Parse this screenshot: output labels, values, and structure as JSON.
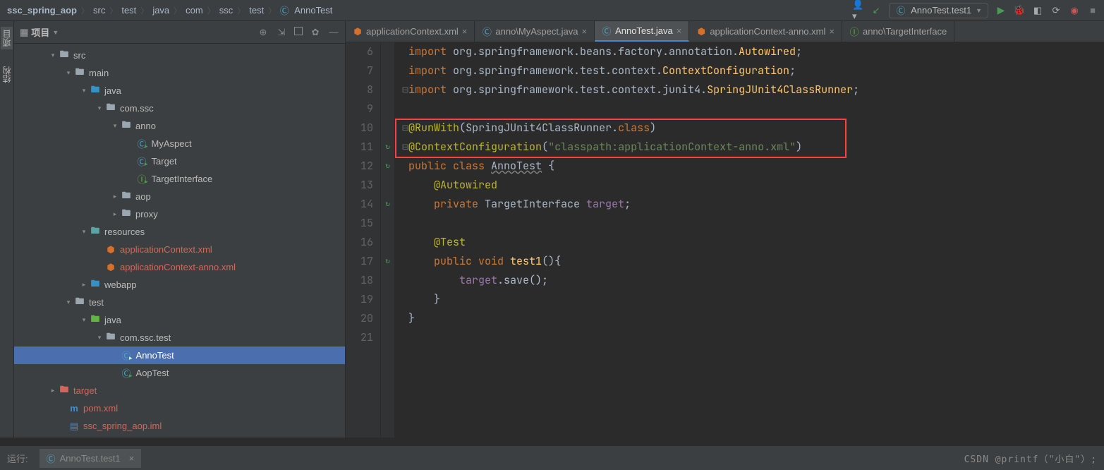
{
  "breadcrumb": [
    "ssc_spring_aop",
    "src",
    "test",
    "java",
    "com",
    "ssc",
    "test",
    "AnnoTest"
  ],
  "runConfig": {
    "label": "AnnoTest.test1"
  },
  "projectPane": {
    "title": "项目"
  },
  "tree": {
    "src": "src",
    "main": "main",
    "java": "java",
    "com_ssc": "com.ssc",
    "anno": "anno",
    "myAspect": "MyAspect",
    "target": "Target",
    "targetInterface": "TargetInterface",
    "aop": "aop",
    "proxy": "proxy",
    "resources": "resources",
    "appCtx": "applicationContext.xml",
    "appCtxAnno": "applicationContext-anno.xml",
    "webapp": "webapp",
    "test": "test",
    "java2": "java",
    "com_ssc_test": "com.ssc.test",
    "annoTest": "AnnoTest",
    "aopTest": "AopTest",
    "targetDir": "target",
    "pom": "pom.xml",
    "iml": "ssc_spring_aop.iml"
  },
  "tabs": [
    {
      "label": "applicationContext.xml",
      "type": "xml",
      "active": false
    },
    {
      "label": "anno\\MyAspect.java",
      "type": "java",
      "active": false
    },
    {
      "label": "AnnoTest.java",
      "type": "java",
      "active": true
    },
    {
      "label": "applicationContext-anno.xml",
      "type": "xml",
      "active": false
    },
    {
      "label": "anno\\TargetInterface",
      "type": "java",
      "active": false
    }
  ],
  "gutter": {
    "start": 6,
    "end": 21,
    "runMarkers": [
      11,
      12,
      14,
      17
    ]
  },
  "code": {
    "l6": {
      "kw": "import",
      "pkg": " org.springframework.beans.factory.annotation.",
      "cls": "Autowired",
      "end": ";"
    },
    "l7": {
      "kw": "import",
      "pkg": " org.springframework.test.context.",
      "cls": "ContextConfiguration",
      "end": ";"
    },
    "l8": {
      "kw": "import",
      "pkg": " org.springframework.test.context.junit4.",
      "cls": "SpringJUnit4ClassRunner",
      "end": ";"
    },
    "l10": {
      "anno": "@RunWith",
      "open": "(",
      "arg": "SpringJUnit4ClassRunner",
      "dot": ".",
      "kw": "class",
      "close": ")"
    },
    "l11": {
      "anno": "@ContextConfiguration",
      "open": "(",
      "str": "\"classpath:applicationContext-anno.xml\"",
      "close": ")"
    },
    "l12": {
      "kw1": "public ",
      "kw2": "class ",
      "cls": "AnnoTest",
      "brace": " {"
    },
    "l13": {
      "anno": "@Autowired"
    },
    "l14": {
      "kw": "private ",
      "type": "TargetInterface ",
      "field": "target",
      "end": ";"
    },
    "l16": {
      "anno": "@Test"
    },
    "l17": {
      "kw1": "public ",
      "kw2": "void ",
      "fn": "test1",
      "paren": "()",
      "brace": "{"
    },
    "l18": {
      "field": "target",
      "call": ".save();"
    },
    "l19": "}",
    "l20": "}"
  },
  "statusbar": {
    "runLabel": "运行:",
    "runTab": "AnnoTest.test1",
    "watermark": "CSDN @printf（\"小白\"）;"
  },
  "sideTabs": {
    "project": "项目",
    "structure": "结构"
  }
}
